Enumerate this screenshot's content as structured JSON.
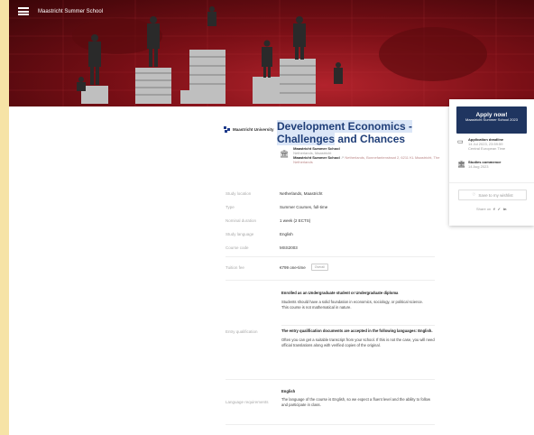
{
  "header": {
    "site_name": "Maastricht Summer School"
  },
  "university": {
    "name": "Maastricht University"
  },
  "course": {
    "title_hl": "Development Economics - Challenges",
    "title_rest": "and Chances"
  },
  "school": {
    "name": "Maastricht Summer School",
    "location": "Netherlands, Maastricht",
    "link_label": "Maastricht Summer School",
    "address": "Netherlands, Bonnefantenstraat 2, 6211 KL Maastricht, The Netherlands"
  },
  "facts": [
    {
      "key": "Study location",
      "value": "Netherlands, Maastricht"
    },
    {
      "key": "Type",
      "value": "Summer Courses, full-time"
    },
    {
      "key": "Nominal duration",
      "value": "1 week (2 ECTS)"
    },
    {
      "key": "Study language",
      "value": "English"
    },
    {
      "key": "Course code",
      "value": "MSS2003"
    }
  ],
  "tuition": {
    "key": "Tuition fee",
    "value": "€799 one-time",
    "badge": "Overall"
  },
  "entry": {
    "label": "Entry qualification",
    "heading1": "Enrolled as an Undergraduate student or Undergraduate diploma",
    "text1": "Students should have a solid foundation in economics, sociology, or political science.",
    "text1b": "This course is not mathematical in nature.",
    "heading2": "The entry qualification documents are accepted in the following languages: English.",
    "text2": "Often you can get a suitable transcript from your school. If this is not the case, you will need official translations along with verified copies of the original."
  },
  "language": {
    "label": "Language requirements",
    "heading": "English",
    "text": "The language of the course is English, so we expect a fluent level and the ability to follow and participate in class."
  },
  "sidebar": {
    "apply_label": "Apply now!",
    "apply_sub": "Maastricht Summer School 2023",
    "deadline_label": "Application deadline",
    "deadline_date": "14 Jul 2023, 23:59:59",
    "deadline_tz": "Central European Time",
    "start_label": "Studies commence",
    "start_date": "14 Aug 2023",
    "wishlist_label": "Save to my wishlist",
    "share_label": "Share on"
  }
}
